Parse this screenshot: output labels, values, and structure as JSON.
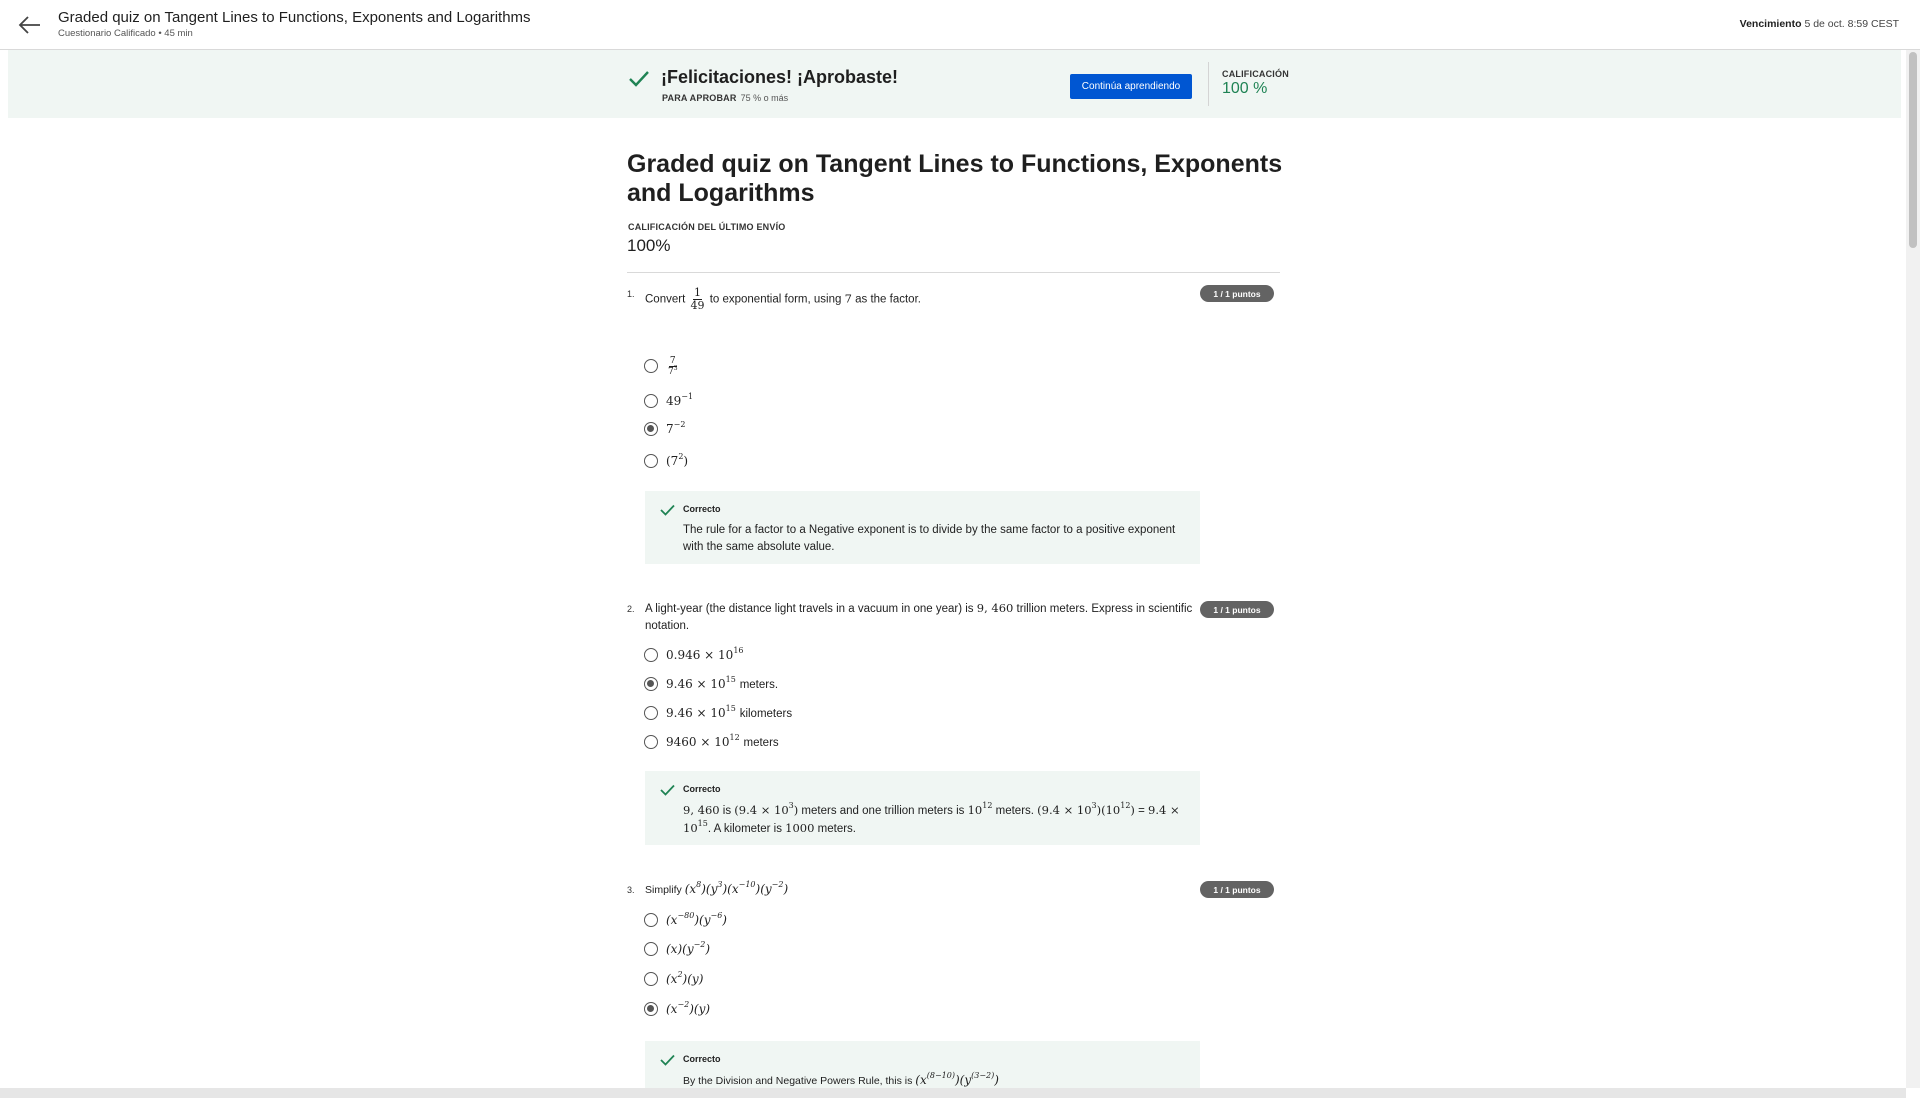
{
  "header": {
    "title": "Graded quiz on Tangent Lines to Functions, Exponents and Logarithms",
    "subtitle": "Cuestionario Calificado • 45 min",
    "due_label": "Vencimiento",
    "due_value": "5 de oct. 8:59 CEST"
  },
  "banner": {
    "title": "¡Felicitaciones! ¡Aprobaste!",
    "pass_label": "PARA APROBAR",
    "pass_value": "75 % o más",
    "continue_button": "Continúa aprendiendo",
    "grade_label": "CALIFICACIÓN",
    "grade_value": "100 %"
  },
  "main": {
    "title": "Graded quiz on Tangent Lines to Functions, Exponents and Logarithms",
    "last_submission_label": "CALIFICACIÓN DEL ÚLTIMO ENVÍO",
    "last_submission_value": "100%"
  },
  "questions": [
    {
      "number": "1.",
      "points": "1 / 1 puntos",
      "text_before": "Convert",
      "fraction_num": "1",
      "fraction_den": "49",
      "text_after": "to exponential form, using",
      "factor": "7",
      "text_end": "as the factor.",
      "selected_index": 2,
      "feedback_label": "Correcto",
      "feedback_text": "The rule for a factor to a Negative exponent is to divide by the same factor to a positive exponent with the same absolute value."
    },
    {
      "number": "2.",
      "points": "1 / 1 puntos",
      "text_before": "A light-year (the distance light travels in a vacuum in one year) is",
      "value": "9, 460",
      "text_after": "trillion meters. Express in scientific notation.",
      "selected_index": 1,
      "feedback_label": "Correcto"
    },
    {
      "number": "3.",
      "points": "1 / 1 puntos",
      "text_before": "Simplify",
      "selected_index": 3,
      "feedback_label": "Correcto",
      "feedback_text_before": "By the Division and Negative Powers Rule, this is"
    }
  ]
}
